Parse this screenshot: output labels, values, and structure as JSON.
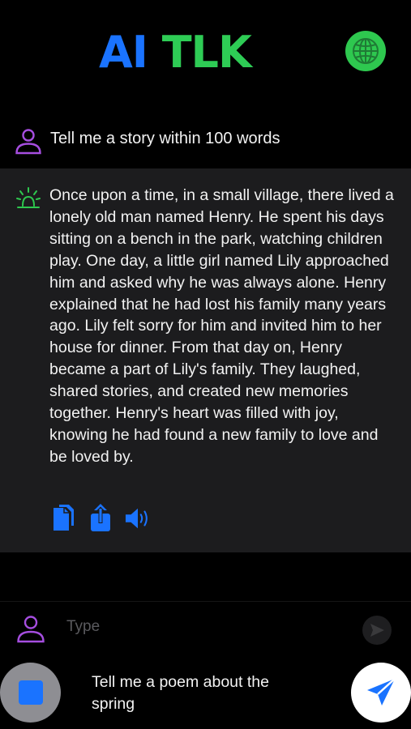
{
  "header": {
    "logo_part1": "AI",
    "logo_part2": "TLK",
    "globe_icon": "globe-icon"
  },
  "conversation": {
    "user_message": "Tell me a story within 100 words",
    "ai_response": "Once upon a time, in a small village, there lived a lonely old man named Henry. He spent his days sitting on a bench in the park, watching children play. One day, a little girl named Lily approached him and asked why he was always alone. Henry explained that he had lost his family many years ago. Lily felt sorry for him and invited him to her house for dinner. From that day on, Henry became a part of Lily's family. They laughed, shared stories, and created new memories together. Henry's heart was filled with joy, knowing he had found a new family to love and be loved by.",
    "actions": [
      "copy-icon",
      "share-icon",
      "speaker-icon"
    ]
  },
  "composer": {
    "placeholder": "Type",
    "suggestion": "Tell me a poem about the spring"
  },
  "colors": {
    "accent_blue": "#1a73ff",
    "logo_green": "#2ecc55",
    "user_purple": "#a64ee0",
    "ai_green": "#2ec84f",
    "ai_bubble_bg": "#1c1c1e"
  }
}
